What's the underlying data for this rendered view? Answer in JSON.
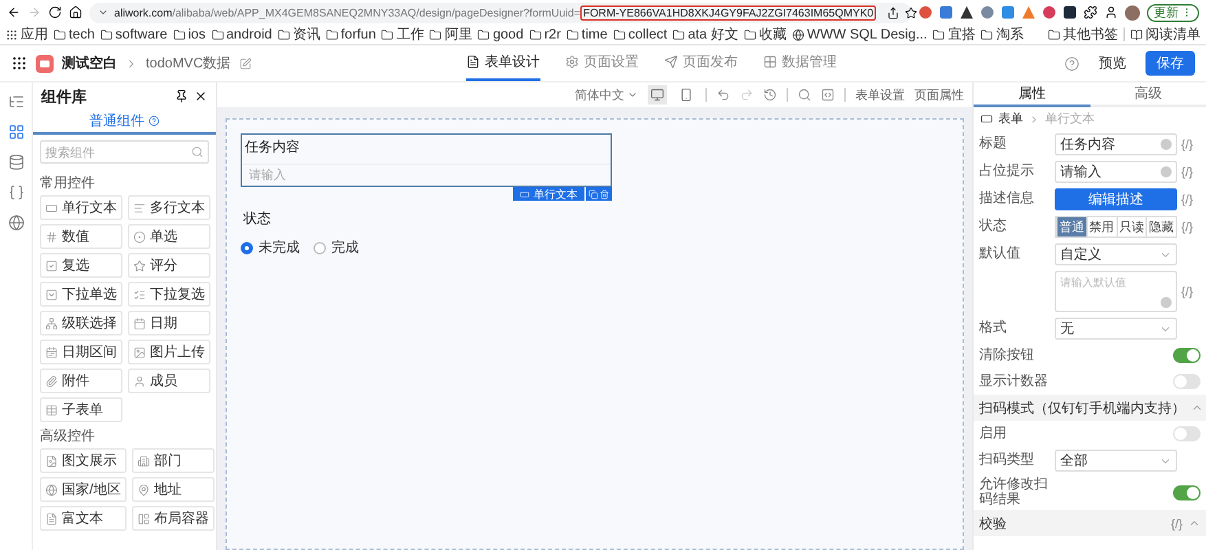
{
  "browser": {
    "url": {
      "host": "aliwork.com",
      "path": "/alibaba/web/APP_MX4GEM8SANEQ2MNY33AQ/design/pageDesigner?formUuid=",
      "highlighted": "FORM-YE866VA1HD8XKJ4GY9FAJ2ZGI7463IM65QMYK0"
    },
    "update_button": "更新"
  },
  "bookmarks": [
    {
      "kind": "apps",
      "label": "应用"
    },
    {
      "kind": "folder",
      "label": "tech"
    },
    {
      "kind": "folder",
      "label": "software"
    },
    {
      "kind": "folder",
      "label": "ios"
    },
    {
      "kind": "folder",
      "label": "android"
    },
    {
      "kind": "folder",
      "label": "资讯"
    },
    {
      "kind": "folder",
      "label": "forfun"
    },
    {
      "kind": "folder",
      "label": "工作"
    },
    {
      "kind": "folder",
      "label": "阿里"
    },
    {
      "kind": "folder",
      "label": "good"
    },
    {
      "kind": "folder",
      "label": "r2r"
    },
    {
      "kind": "folder",
      "label": "time"
    },
    {
      "kind": "folder",
      "label": "collect"
    },
    {
      "kind": "folder",
      "label": "ata 好文"
    },
    {
      "kind": "folder",
      "label": "收藏"
    },
    {
      "kind": "site",
      "label": "WWW SQL Desig..."
    },
    {
      "kind": "folder",
      "label": "宜搭"
    },
    {
      "kind": "folder",
      "label": "淘系"
    }
  ],
  "bookmarks_right": [
    {
      "kind": "folder",
      "label": "其他书签"
    },
    {
      "kind": "reading",
      "label": "阅读清单"
    }
  ],
  "app_header": {
    "app_name": "测试空白",
    "page_name": "todoMVC数据",
    "tabs": [
      {
        "label": "表单设计",
        "selected": true
      },
      {
        "label": "页面设置",
        "selected": false
      },
      {
        "label": "页面发布",
        "selected": false
      },
      {
        "label": "数据管理",
        "selected": false
      }
    ],
    "preview_button": "预览",
    "save_button": "保存"
  },
  "side_rail": [
    {
      "selected": false
    },
    {
      "selected": true
    },
    {
      "selected": false
    },
    {
      "selected": false
    },
    {
      "selected": false
    }
  ],
  "component_panel": {
    "title": "组件库",
    "tab": "普通组件",
    "search_placeholder": "搜索组件",
    "groups": [
      {
        "title": "常用控件",
        "items": [
          "单行文本",
          "多行文本",
          "数值",
          "单选",
          "复选",
          "评分",
          "下拉单选",
          "下拉复选",
          "级联选择",
          "日期",
          "日期区间",
          "图片上传",
          "附件",
          "成员",
          "子表单"
        ]
      },
      {
        "title": "高级控件",
        "items": [
          "图文展示",
          "部门",
          "国家/地区",
          "地址",
          "富文本",
          "布局容器"
        ]
      }
    ]
  },
  "canvas_toolbar": {
    "language": "简体中文",
    "devices": [
      {
        "selected": true
      },
      {
        "selected": false
      }
    ],
    "links": [
      "表单设置",
      "页面属性"
    ]
  },
  "form": {
    "fields": [
      {
        "kind": "text",
        "label": "任务内容",
        "placeholder": "请输入",
        "selected": true,
        "tag": "单行文本"
      },
      {
        "kind": "radio",
        "label": "状态",
        "options": [
          {
            "label": "未完成",
            "selected": true
          },
          {
            "label": "完成",
            "selected": false
          }
        ]
      }
    ]
  },
  "properties": {
    "tabs": [
      {
        "label": "属性",
        "selected": true
      },
      {
        "label": "高级",
        "selected": false
      }
    ],
    "breadcrumb": [
      "表单",
      "单行文本"
    ],
    "rows": [
      {
        "kind": "input",
        "label": "标题",
        "value": "任务内容",
        "variable": "{/}"
      },
      {
        "kind": "input",
        "label": "占位提示",
        "value": "请输入",
        "variable": "{/}"
      },
      {
        "kind": "button",
        "label": "描述信息",
        "text": "编辑描述",
        "variable": "{/}"
      },
      {
        "kind": "segmented",
        "label": "状态",
        "options": [
          {
            "label": "普通",
            "selected": true
          },
          {
            "label": "禁用",
            "selected": false
          },
          {
            "label": "只读",
            "selected": false
          },
          {
            "label": "隐藏",
            "selected": false
          }
        ],
        "variable": "{/}"
      },
      {
        "kind": "select",
        "label": "默认值",
        "value": "自定义"
      },
      {
        "kind": "textarea",
        "placeholder": "请输入默认值",
        "variable": "{/}"
      },
      {
        "kind": "select",
        "label": "格式",
        "value": "无"
      },
      {
        "kind": "toggle",
        "label": "清除按钮",
        "on": true
      },
      {
        "kind": "toggle",
        "label": "显示计数器",
        "on": false
      },
      {
        "kind": "section",
        "title": "扫码模式（仅钉钉手机端内支持）",
        "expanded": true
      },
      {
        "kind": "toggle",
        "label": "启用",
        "on": false
      },
      {
        "kind": "select",
        "label": "扫码类型",
        "value": "全部"
      },
      {
        "kind": "toggle",
        "label": "允许修改扫码结果",
        "on": true
      },
      {
        "kind": "section",
        "title": "校验",
        "variable": "{/}",
        "expanded": true
      }
    ]
  }
}
